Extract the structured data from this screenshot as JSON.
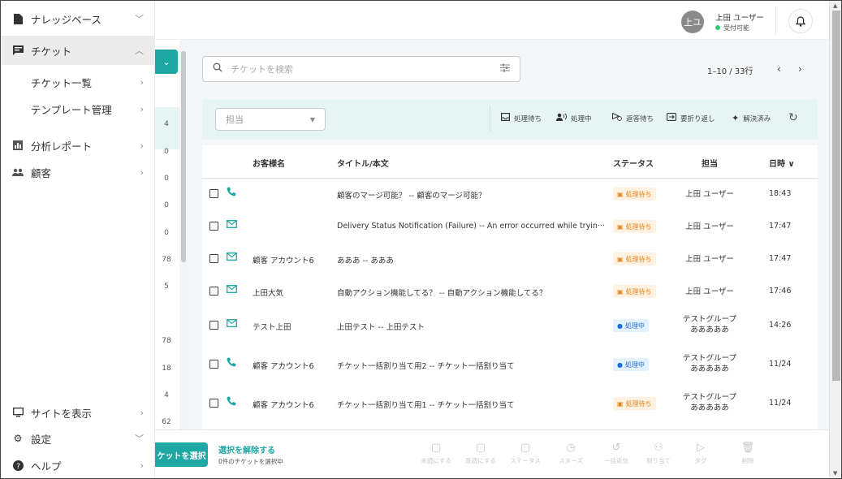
{
  "sidebar": {
    "items": [
      {
        "label": "ナレッジベース",
        "icon": "document-icon",
        "chevron": "﹀"
      },
      {
        "label": "チケット",
        "icon": "ticket-icon",
        "chevron": "︿"
      },
      {
        "label": "チケット一覧",
        "chevron": "›"
      },
      {
        "label": "テンプレート管理",
        "chevron": "›"
      },
      {
        "label": "分析レポート",
        "icon": "chart-icon",
        "chevron": "›"
      },
      {
        "label": "顧客",
        "icon": "users-icon",
        "chevron": "›"
      }
    ],
    "bottom": [
      {
        "label": "サイトを表示",
        "icon": "monitor-icon",
        "chevron": "›"
      },
      {
        "label": "設定",
        "icon": "gear-icon",
        "chevron": "﹀"
      },
      {
        "label": "ヘルプ",
        "icon": "help-icon",
        "chevron": "›"
      }
    ]
  },
  "midcol": {
    "numbers": [
      "4",
      "0",
      "0",
      "0",
      "0",
      "78",
      "5",
      "78",
      "18",
      "4",
      "62"
    ]
  },
  "topbar": {
    "avatar_text": "上ユ",
    "user_name": "上田 ユーザー",
    "user_status": "受付可能",
    "status_color": "#2ecc71"
  },
  "search": {
    "placeholder": "チケットを検索"
  },
  "pager": {
    "range": "1–10 / 33行",
    "prev": "‹",
    "next": "›"
  },
  "filters": {
    "assignee_placeholder": "担当",
    "statuses": [
      "処理待ち",
      "処理中",
      "返答待ち",
      "要折り返し",
      "解決済み"
    ]
  },
  "table": {
    "headers": {
      "customer": "お客様名",
      "title": "タイトル/本文",
      "status": "ステータス",
      "owner": "担当",
      "time": "日時 ∨"
    },
    "rows": [
      {
        "channel": "phone",
        "customer": "",
        "title": "顧客のマージ可能？ -- 顧客のマージ可能？",
        "status": "処理待ち",
        "status_type": "pending",
        "owner": "上田 ユーザー",
        "time": "18:43"
      },
      {
        "channel": "mail",
        "customer": "",
        "title": "Delivery Status Notification (Failure) -- An error occurred while tryin···",
        "status": "処理待ち",
        "status_type": "pending",
        "owner": "上田 ユーザー",
        "time": "17:47"
      },
      {
        "channel": "mail",
        "customer": "顧客 アカウント6",
        "title": "あああ -- あああ",
        "status": "処理待ち",
        "status_type": "pending",
        "owner": "上田 ユーザー",
        "time": "17:47"
      },
      {
        "channel": "mail",
        "customer": "上田大気",
        "title": "自動アクション機能してる？ -- 自動アクション機能してる？",
        "status": "処理待ち",
        "status_type": "pending",
        "owner": "上田 ユーザー",
        "time": "17:46"
      },
      {
        "channel": "mail",
        "customer": "テスト上田",
        "title": "上田テスト -- 上田テスト",
        "status": "処理中",
        "status_type": "inprog",
        "owner": "テストグループあああああ",
        "time": "14:26"
      },
      {
        "channel": "phone",
        "customer": "顧客 アカウント6",
        "title": "チケット一括割り当て用2 -- チケット一括割り当て",
        "status": "処理中",
        "status_type": "inprog",
        "owner": "テストグループあああああ",
        "time": "11/24"
      },
      {
        "channel": "phone",
        "customer": "顧客 アカウント6",
        "title": "チケット一括割り当て用1 -- チケット一括割り当て",
        "status": "処理待ち",
        "status_type": "pending",
        "owner": "テストグループあああああ",
        "time": "11/24"
      }
    ]
  },
  "bottombar": {
    "select_button": "ケットを選択",
    "deselect": "選択を解除する",
    "selected_count": "0件のチケットを選択中",
    "actions": [
      "未読にする",
      "既読にする",
      "ステータス",
      "スヌーズ",
      "一括返信",
      "割り当て",
      "タグ",
      "削除"
    ]
  },
  "colors": {
    "accent": "#1fa7a4",
    "pending": "#e6821e",
    "in_progress": "#1e6fd6"
  }
}
